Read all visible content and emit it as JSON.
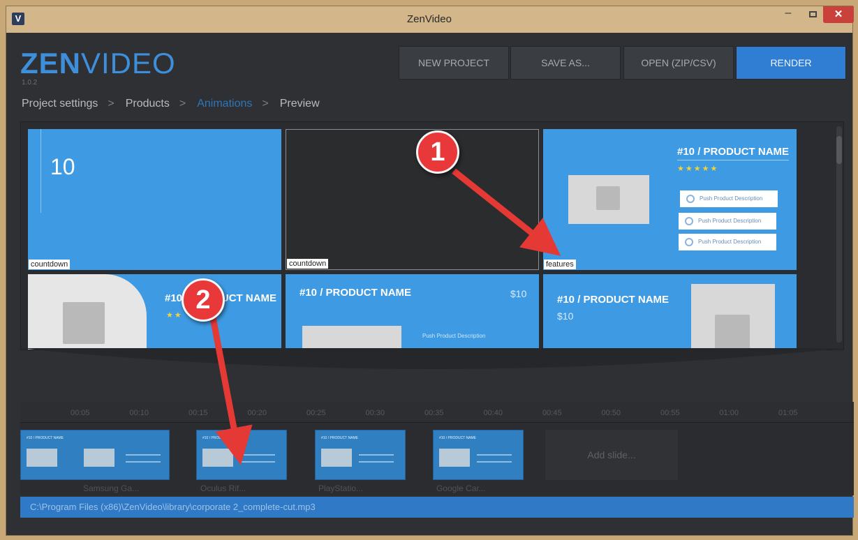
{
  "window": {
    "app_icon": "V",
    "title": "ZenVideo",
    "min_glyph": "–",
    "close_glyph": "✕"
  },
  "logo": {
    "bold": "ZEN",
    "light": "VIDEO",
    "version": "1.0.2"
  },
  "toolbar": {
    "new_project": "NEW PROJECT",
    "save_as": "SAVE AS...",
    "open": "OPEN (ZIP/CSV)",
    "render": "RENDER"
  },
  "breadcrumb": {
    "items": [
      "Project settings",
      "Products",
      "Animations",
      "Preview"
    ],
    "separator": ">",
    "active": "Animations"
  },
  "gallery": {
    "tiles": [
      {
        "label": "countdown",
        "number": "10"
      },
      {
        "label": "countdown"
      },
      {
        "label": "features",
        "title": "#10 / PRODUCT NAME",
        "stars": "★★★★★",
        "features": [
          "Push Product Description",
          "Push Product Description",
          "Push Product Description"
        ]
      },
      {
        "title": "#10 / PRODUCT NAME",
        "stars": "★★"
      },
      {
        "title": "#10 / PRODUCT NAME",
        "price": "$10",
        "feature": "Push Product Description"
      },
      {
        "title": "#10 / PRODUCT NAME",
        "price": "$10"
      }
    ]
  },
  "timeline": {
    "ticks": [
      "00:05",
      "00:10",
      "00:15",
      "00:20",
      "00:25",
      "00:30",
      "00:35",
      "00:40",
      "00:45",
      "00:50",
      "00:55",
      "01:00",
      "01:05"
    ],
    "clips": [
      {
        "caption": "Samsung Ga...",
        "head": "#10 / PRODUCT NAME"
      },
      {
        "caption": "Oculus Rif...",
        "head": "#10 / PRODUCT NAME"
      },
      {
        "caption": "PlayStatio...",
        "head": "#10 / PRODUCT NAME"
      },
      {
        "caption": "Google Car...",
        "head": "#10 / PRODUCT NAME"
      }
    ],
    "add_slide": "Add slide..."
  },
  "audio_file": "C:\\Program Files (x86)\\ZenVideo\\library\\corporate 2_complete-cut.mp3",
  "annotations": {
    "marker1": "1",
    "marker2": "2"
  },
  "colors": {
    "accent": "#2f7ed3",
    "tile_blue": "#3e9be3",
    "marker_red": "#e8383a"
  }
}
